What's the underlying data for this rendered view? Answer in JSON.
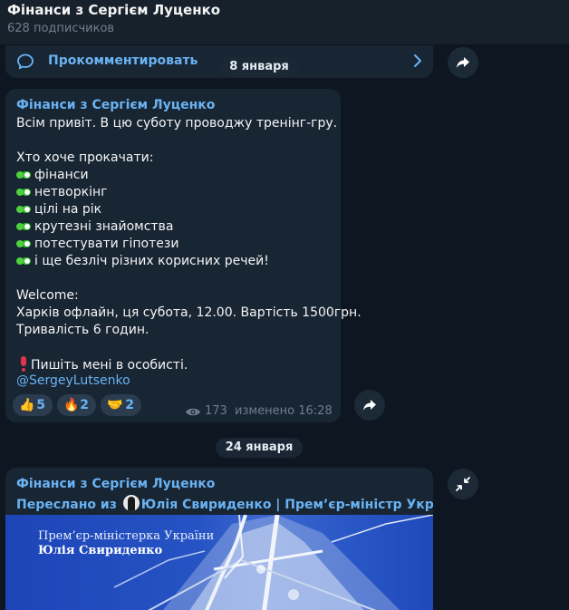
{
  "header": {
    "title": "Фінанси з Сергієм Луценко",
    "subscribers": "628 подписчиков"
  },
  "comment_bar": {
    "label": "Прокомментировать"
  },
  "dates": {
    "first": "8 января",
    "second": "24 января"
  },
  "message1": {
    "author": "Фінанси з Сергієм Луценко",
    "intro": "Всім привіт. В цю суботу проводжу тренінг-гру.",
    "list_heading": "Хто хоче прокачати:",
    "items": [
      "фінанси",
      "нетворкінг",
      "цілі на рік",
      "крутезні знайомства",
      "потестувати гіпотези",
      "і ще безліч різних корисних речей!"
    ],
    "welcome": "Welcome:",
    "details_line1": "Харків офлайн, ця субота, 12.00. Вартість 1500грн.",
    "details_line2": "Тривалість 6 годин.",
    "cta": "Пишіть мені в особисті.",
    "mention": "@SergeyLutsenko",
    "reactions": [
      {
        "emoji": "👍",
        "count": "5"
      },
      {
        "emoji": "🔥",
        "count": "2"
      },
      {
        "emoji": "🤝",
        "count": "2"
      }
    ],
    "views": "173",
    "edited": "изменено 16:28"
  },
  "message2": {
    "author": "Фінанси з Сергієм Луценко",
    "forwarded_prefix": "Переслано из",
    "forwarded_from": "Юлія Свириденко | Прем’єр-міністр України",
    "photo_title": "Прем’єр-міністерка України",
    "photo_name": "Юлія Свириденко"
  },
  "colors": {
    "background": "#0e1621",
    "bubble": "#182533",
    "accent": "#6ab3f3",
    "meta": "#6d7f8f"
  },
  "icons": {
    "comment": "comment-bubble-icon",
    "chevron": "chevron-right-icon",
    "share": "share-arrow-icon",
    "views": "eye-icon",
    "collapse": "collapse-arrows-icon"
  }
}
